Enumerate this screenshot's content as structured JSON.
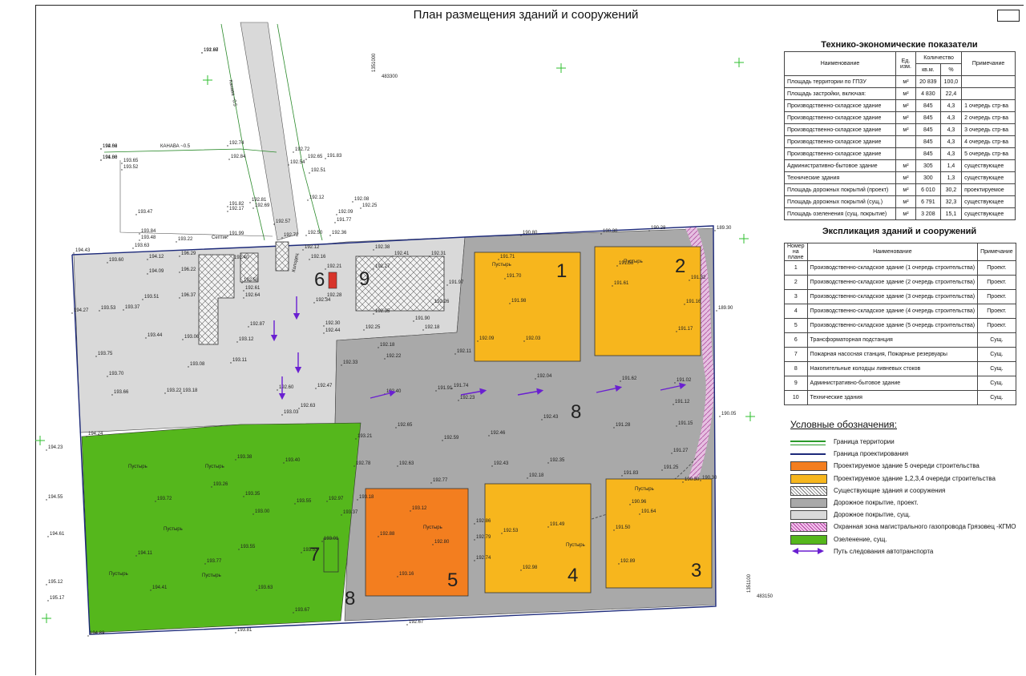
{
  "title": "План размещения зданий и сооружений",
  "tep": {
    "title": "Технико-экономические показатели",
    "headers": {
      "name": "Наименование",
      "unit": "Ед. изм.",
      "qty": "Количество",
      "qty_a": "кв.м.",
      "qty_b": "%",
      "note": "Примечание"
    },
    "rows": [
      [
        "Площадь территории по ГПЗУ",
        "м²",
        "20 839",
        "100,0",
        ""
      ],
      [
        "Площадь застройки, включая:",
        "м²",
        "4 830",
        "22,4",
        ""
      ],
      [
        "Производственно-складское здание",
        "м²",
        "845",
        "4,3",
        "1 очередь стр-ва"
      ],
      [
        "Производственно-складское здание",
        "м²",
        "845",
        "4,3",
        "2 очередь стр-ва"
      ],
      [
        "Производственно-складское здание",
        "м²",
        "845",
        "4,3",
        "3 очередь стр-ва"
      ],
      [
        "Производственно-складское здание",
        "",
        "845",
        "4,3",
        "4 очередь стр-ва"
      ],
      [
        "Производственно-складское здание",
        "",
        "845",
        "4,3",
        "5 очередь стр-ва"
      ],
      [
        "Административно-бытовое здание",
        "м²",
        "305",
        "1,4",
        "существующее"
      ],
      [
        "Технические здания",
        "м²",
        "300",
        "1,3",
        "существующее"
      ],
      [
        "Площадь дорожных покрытий (проект)",
        "м²",
        "6 010",
        "30,2",
        "проектируемое"
      ],
      [
        "Площадь дорожных покрытий (сущ.)",
        "м²",
        "6 791",
        "32,3",
        "существующее"
      ],
      [
        "Площадь озеленения (сущ. покрытие)",
        "м²",
        "3 208",
        "15,1",
        "существующее"
      ]
    ]
  },
  "expl": {
    "title": "Экспликация зданий и сооружений",
    "headers": {
      "no": "Номер на плане",
      "name": "Наименование",
      "note": "Примечание"
    },
    "rows": [
      [
        "1",
        "Производственно-складское здание (1 очередь строительства)",
        "Проект."
      ],
      [
        "2",
        "Производственно-складское здание (2 очередь строительства)",
        "Проект."
      ],
      [
        "3",
        "Производственно-складское здание (3 очередь строительства)",
        "Проект."
      ],
      [
        "4",
        "Производственно-складское здание (4 очередь строительства)",
        "Проект."
      ],
      [
        "5",
        "Производственно-складское здание (5 очередь строительства)",
        "Проект."
      ],
      [
        "6",
        "Трансформаторная подстанция",
        "Сущ."
      ],
      [
        "7",
        "Пожарная насосная станция, Пожарные резервуары",
        "Сущ."
      ],
      [
        "8",
        "Накопительные колодцы ливневых стоков",
        "Сущ."
      ],
      [
        "9",
        "Административно-бытовое здание",
        "Сущ."
      ],
      [
        "10",
        "Технические здания",
        "Сущ."
      ]
    ]
  },
  "legend": {
    "title": "Условные обозначения:",
    "items": [
      {
        "label": "Граница территории",
        "kind": "line-green"
      },
      {
        "label": "Граница проектирования",
        "kind": "line-navy"
      },
      {
        "label": "Проектируемое здание 5 очереди строительства",
        "kind": "fill",
        "color": "#f37e1f"
      },
      {
        "label": "Проектируемое здание 1,2,3,4 очереди строительства",
        "kind": "fill",
        "color": "#f7b61d"
      },
      {
        "label": "Существующие здания и сооружения",
        "kind": "hatch"
      },
      {
        "label": "Дорожное покрытие, проект.",
        "kind": "fill",
        "color": "#a9a9a9"
      },
      {
        "label": "Дорожное покрытие, сущ.",
        "kind": "fill",
        "color": "#d9d9d9"
      },
      {
        "label": "Охранная зона магистрального газопровода Грязовец -КГМО",
        "kind": "pink"
      },
      {
        "label": "Озеленение, сущ.",
        "kind": "fill",
        "color": "#55b71c"
      },
      {
        "label": "Путь следования автотранспорта",
        "kind": "arrow"
      }
    ]
  },
  "plan": {
    "buildings": [
      {
        "num": "1",
        "label": "Пустырь"
      },
      {
        "num": "2",
        "label": "Пустырь"
      },
      {
        "num": "3",
        "label": "Пустырь"
      },
      {
        "num": "4",
        "label": "Пустырь"
      },
      {
        "num": "5",
        "label": "Пустырь"
      },
      {
        "num": "6",
        "label": ""
      },
      {
        "num": "7",
        "label": ""
      },
      {
        "num": "8",
        "label": ""
      },
      {
        "num": "8",
        "label": ""
      },
      {
        "num": "9",
        "label": ""
      }
    ],
    "road_labels": [
      "КАНАВА ~0.5",
      "Канава ~0.5",
      "Септик",
      "Колодец"
    ],
    "green_label": "Пустырь",
    "elevations": [
      "192.67",
      "194.02",
      "194.00",
      "193.65",
      "193.52",
      "193.47",
      "193.84",
      "193.48",
      "193.63",
      "193.22",
      "194.43",
      "193.60",
      "194.12",
      "196.29",
      "194.09",
      "196.22",
      "193.51",
      "196.37",
      "193.37",
      "194.27",
      "193.53",
      "193.44",
      "193.06",
      "193.75",
      "193.70",
      "193.66",
      "193.22",
      "193.18",
      "193.08",
      "193.11",
      "193.12",
      "192.87",
      "192.60",
      "192.47",
      "192.63",
      "193.03",
      "194.24",
      "194.23",
      "193.38",
      "193.40",
      "193.26",
      "193.35",
      "193.72",
      "193.55",
      "192.97",
      "193.00",
      "193.37",
      "194.55",
      "194.61",
      "194.11",
      "193.77",
      "193.55",
      "193.01",
      "193.53",
      "195.12",
      "195.17",
      "194.41",
      "193.63",
      "193.67",
      "194.89",
      "193.81",
      "192.67",
      "192.33",
      "192.22",
      "192.18",
      "192.40",
      "191.91",
      "192.23",
      "191.74",
      "192.04",
      "191.62",
      "191.02",
      "191.12",
      "190.05",
      "192.65",
      "192.59",
      "192.46",
      "192.43",
      "191.28",
      "191.15",
      "191.27",
      "193.21",
      "192.78",
      "192.63",
      "192.43",
      "192.35",
      "191.25",
      "190.30",
      "192.77",
      "193.18",
      "193.12",
      "192.18",
      "192.88",
      "192.86",
      "192.79",
      "192.53",
      "191.49",
      "191.83",
      "190.96",
      "191.64",
      "191.50",
      "192.89",
      "192.74",
      "192.98",
      "193.16",
      "192.80",
      "190.30",
      "191.71",
      "191.70",
      "191.98",
      "192.09",
      "192.03",
      "192.11",
      "191.61",
      "191.58",
      "191.32",
      "191.16",
      "191.17",
      "190.80",
      "190.30",
      "190.28",
      "189.30",
      "189.90",
      "192.41",
      "192.31",
      "192.27",
      "191.97",
      "192.26",
      "191.90",
      "192.18",
      "192.35",
      "192.25",
      "192.12",
      "192.16",
      "192.21",
      "192.28",
      "192.30",
      "192.44",
      "192.34",
      "192.40",
      "192.58",
      "192.61",
      "192.64",
      "192.74",
      "192.84",
      "192.72",
      "192.54",
      "192.65",
      "192.51",
      "191.83",
      "192.12",
      "192.08",
      "192.25",
      "192.09",
      "191.77",
      "191.82",
      "192.17",
      "192.81",
      "192.69",
      "192.57",
      "192.72",
      "192.50",
      "192.36",
      "192.38",
      "191.99",
      "191.98",
      "192.66",
      "191.88"
    ],
    "coords": [
      "1351000",
      "483300",
      "1351100",
      "483150"
    ]
  }
}
